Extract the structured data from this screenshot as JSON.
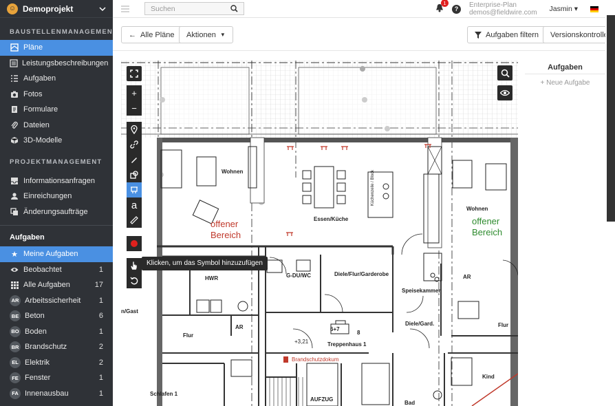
{
  "sidebar": {
    "project": "Demoprojekt",
    "section1": "BAUSTELLENMANAGEMENT",
    "items1": [
      {
        "label": "Pläne",
        "icon": "plans-icon"
      },
      {
        "label": "Leistungsbeschreibungen",
        "icon": "list-doc-icon"
      },
      {
        "label": "Aufgaben",
        "icon": "tasks-icon"
      },
      {
        "label": "Fotos",
        "icon": "camera-icon"
      },
      {
        "label": "Formulare",
        "icon": "form-icon"
      },
      {
        "label": "Dateien",
        "icon": "paperclip-icon"
      },
      {
        "label": "3D-Modelle",
        "icon": "cube-icon"
      }
    ],
    "section2": "PROJEKTMANAGEMENT",
    "items2": [
      {
        "label": "Informationsanfragen",
        "icon": "inbox-icon"
      },
      {
        "label": "Einreichungen",
        "icon": "person-icon"
      },
      {
        "label": "Änderungsaufträge",
        "icon": "change-icon"
      }
    ],
    "section3": "Aufgaben",
    "tasks": [
      {
        "label": "Meine Aufgaben",
        "count": ""
      },
      {
        "label": "Beobachtet",
        "count": "1"
      },
      {
        "label": "Alle Aufgaben",
        "count": "17"
      },
      {
        "label": "Arbeitssicherheit",
        "count": "1",
        "badge": "AR"
      },
      {
        "label": "Beton",
        "count": "6",
        "badge": "BE"
      },
      {
        "label": "Boden",
        "count": "1",
        "badge": "BO"
      },
      {
        "label": "Brandschutz",
        "count": "2",
        "badge": "BR"
      },
      {
        "label": "Elektrik",
        "count": "2",
        "badge": "EL"
      },
      {
        "label": "Fenster",
        "count": "1",
        "badge": "FE"
      },
      {
        "label": "Innenausbau",
        "count": "1",
        "badge": "FA"
      }
    ]
  },
  "topbar": {
    "search_placeholder": "Suchen",
    "notifications": "1",
    "plan_name": "Enterprise-Plan",
    "email": "demos@fieldwire.com",
    "user": "Jasmin"
  },
  "toolbar": {
    "back": "Alle Pläne",
    "actions": "Aktionen",
    "filter": "Aufgaben filtern",
    "version": "Versionskontrolle"
  },
  "right_panel": {
    "title": "Aufgaben",
    "add": "+ Neue Aufgabe"
  },
  "tooltip": "Klicken, um das Symbol hinzuzufügen",
  "plan": {
    "wohnen": "Wohnen",
    "essen": "Essen/Küche",
    "offener1": "offener",
    "bereich1": "Bereich",
    "offener2": "offener",
    "bereich2": "Bereich",
    "wohnen2": "Wohnen",
    "hwr": "HWR",
    "gdu": "G-DU/WC",
    "diele": "Diele/Flur/Garderobe",
    "speise": "Speisekammer",
    "ar1": "AR",
    "ar2": "AR",
    "flur1": "Flur",
    "flur2": "Flur",
    "gast": "n/Gast",
    "treppen": "Treppenhaus 1",
    "tag": "6+7",
    "tag2": "8",
    "level": "+3,21",
    "brand": "Brandschutzdokum",
    "dieleg": "Diele/Gard.",
    "kind": "Kind",
    "schlafen": "Schlafen 1",
    "aufzug": "AUFZUG",
    "bad": "Bad",
    "kuechenzeile": "Küchenzeile / Block"
  }
}
